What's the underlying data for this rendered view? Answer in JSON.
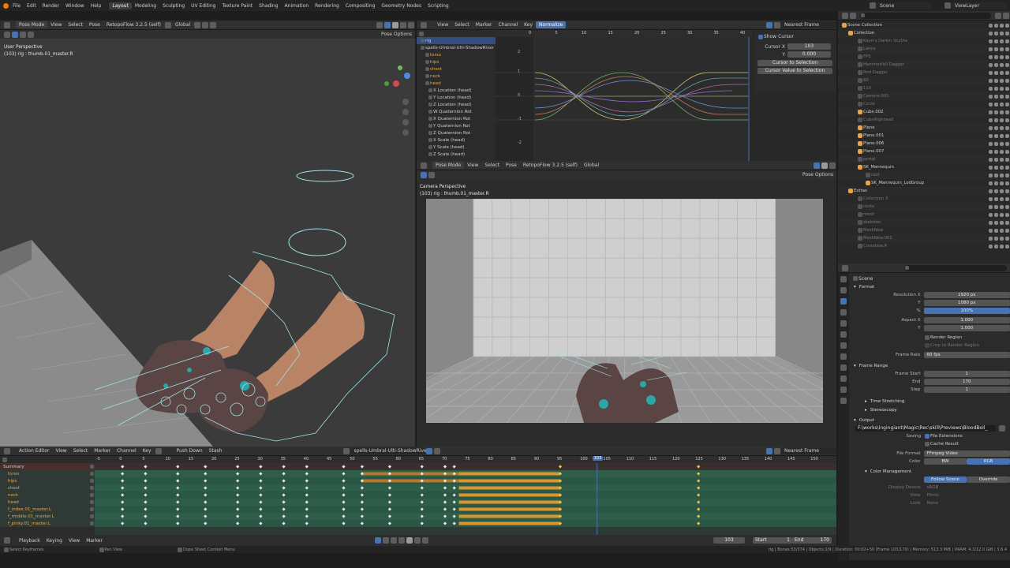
{
  "menubar": {
    "items": [
      "File",
      "Edit",
      "Render",
      "Window",
      "Help"
    ],
    "workspaces": [
      "Layout",
      "Modeling",
      "Sculpting",
      "UV Editing",
      "Texture Paint",
      "Shading",
      "Animation",
      "Rendering",
      "Compositing",
      "Geometry Nodes",
      "Scripting"
    ],
    "scene": "Scene",
    "view_layer": "ViewLayer"
  },
  "viewport3d": {
    "mode": "Pose Mode",
    "menus": [
      "View",
      "Select",
      "Pose"
    ],
    "retopo": "RetopoFlow 3.2.5 (self)",
    "orientation": "Global",
    "pose_options": "Pose Options",
    "perspective": "User Perspective",
    "object": "(103) rig : thumb.01_master.R"
  },
  "graph_editor": {
    "menus": [
      "View",
      "Select",
      "Marker",
      "Channel",
      "Key"
    ],
    "normalize": "Normalize",
    "nearest": "Nearest Frame",
    "ruler": [
      "0",
      "5",
      "10",
      "15",
      "20",
      "25",
      "30",
      "35",
      "40"
    ],
    "y_labels": [
      "2",
      "1",
      "0",
      "-1",
      "-2"
    ],
    "channels": [
      {
        "label": "rig",
        "orange": false
      },
      {
        "label": "spells-Umbral-Ulti-ShadowRiver",
        "orange": false
      },
      {
        "label": "torso",
        "orange": true
      },
      {
        "label": "hips",
        "orange": true
      },
      {
        "label": "chest",
        "orange": true
      },
      {
        "label": "neck",
        "orange": true
      },
      {
        "label": "head",
        "orange": true
      },
      {
        "label": "X Location (head)",
        "orange": false
      },
      {
        "label": "Y Location (head)",
        "orange": false
      },
      {
        "label": "Z Location (head)",
        "orange": false
      },
      {
        "label": "W Quaternion Rot",
        "orange": false
      },
      {
        "label": "X Quaternion Rot",
        "orange": false
      },
      {
        "label": "Y Quaternion Rot",
        "orange": false
      },
      {
        "label": "Z Quaternion Rot",
        "orange": false
      },
      {
        "label": "X Scale (head)",
        "orange": false
      },
      {
        "label": "Y Scale (head)",
        "orange": false
      },
      {
        "label": "Z Scale (head)",
        "orange": false
      }
    ],
    "sidebar": {
      "show_cursor": "Show Cursor",
      "cursor_x_label": "Cursor X",
      "cursor_x": "103",
      "y_label": "Y",
      "cursor_y": "0.000",
      "btn1": "Cursor to Selection",
      "btn2": "Cursor Value to Selection"
    }
  },
  "camera_view": {
    "mode": "Pose Mode",
    "menus": [
      "View",
      "Select",
      "Pose"
    ],
    "retopo": "RetopoFlow 3.2.5 (self)",
    "orientation": "Global",
    "pose_options": "Pose Options",
    "perspective": "Camera Perspective",
    "object": "(103) rig : thumb.01_master.R"
  },
  "outliner": {
    "items": [
      {
        "label": "Scene Collection",
        "dim": false
      },
      {
        "label": "Collection",
        "dim": false
      },
      {
        "label": "Kayn's Darkin Scythe",
        "dim": true
      },
      {
        "label": "Lance",
        "dim": true
      },
      {
        "label": "FPS",
        "dim": true
      },
      {
        "label": "Hammerfell Dagger",
        "dim": true
      },
      {
        "label": "Red Dagger",
        "dim": true
      },
      {
        "label": "60",
        "dim": true
      },
      {
        "label": "110",
        "dim": true
      },
      {
        "label": "Camera.001",
        "dim": true
      },
      {
        "label": "Circle",
        "dim": true
      },
      {
        "label": "Cube.002",
        "dim": false
      },
      {
        "label": "CubeRightwall",
        "dim": true
      },
      {
        "label": "Plane",
        "dim": false
      },
      {
        "label": "Plane.001",
        "dim": false
      },
      {
        "label": "Plane.006",
        "dim": false
      },
      {
        "label": "Plane.007",
        "dim": false
      },
      {
        "label": "portal",
        "dim": true
      },
      {
        "label": "SK_Mannequin",
        "dim": false
      },
      {
        "label": "root",
        "dim": true
      },
      {
        "label": "SK_Mannequin_LodGroup",
        "dim": false
      },
      {
        "label": "Extras",
        "dim": false
      },
      {
        "label": "Collection 3",
        "dim": true
      },
      {
        "label": "rocks",
        "dim": true
      },
      {
        "label": "mesh",
        "dim": true
      },
      {
        "label": "skeleton",
        "dim": true
      },
      {
        "label": "MeshNew",
        "dim": true
      },
      {
        "label": "MeshNew.001",
        "dim": true
      },
      {
        "label": "Crossbow.R",
        "dim": true
      }
    ]
  },
  "properties": {
    "scene_label": "Scene",
    "format": {
      "title": "Format",
      "res_x_label": "Resolution X",
      "res_x": "1920 px",
      "y_label": "Y",
      "res_y": "1080 px",
      "pct_label": "%",
      "pct": "100%",
      "aspect_x_label": "Aspect X",
      "aspect_x": "1.000",
      "aspect_y": "1.000",
      "render_region": "Render Region",
      "crop": "Crop to Render Region",
      "frame_rate_label": "Frame Rate",
      "frame_rate": "60 fps"
    },
    "frame_range": {
      "title": "Frame Range",
      "start_label": "Frame Start",
      "start": "1",
      "end_label": "End",
      "end": "170",
      "step_label": "Step",
      "step": "1"
    },
    "time_stretching": "Time Stretching",
    "stereoscopy": "Stereoscopy",
    "output": {
      "title": "Output",
      "path": "F:\\works\\ingingiant\\Magic\\Rec\\skill\\Previews\\BloodBoil_",
      "saving_label": "Saving",
      "file_ext": "File Extensions",
      "cache": "Cache Result",
      "file_format_label": "File Format",
      "file_format": "FFmpeg Video",
      "color_label": "Color",
      "bw": "BW",
      "rgb": "RGB"
    },
    "color_management": {
      "title": "Color Management",
      "follow": "Follow Scene",
      "override": "Override",
      "display_device_label": "Display Device",
      "display_device": "sRGB",
      "view_label": "View",
      "view": "Filmic",
      "look_label": "Look",
      "look": "None"
    }
  },
  "dopesheet": {
    "mode": "Action Editor",
    "menus": [
      "View",
      "Select",
      "Marker",
      "Channel",
      "Key"
    ],
    "push_down": "Push Down",
    "stash": "Stash",
    "action": "spells-Umbral-Ulti-ShadowRiver",
    "nearest": "Nearest Frame",
    "ruler": [
      "-5",
      "0",
      "5",
      "10",
      "15",
      "20",
      "25",
      "30",
      "35",
      "40",
      "45",
      "50",
      "55",
      "60",
      "65",
      "70",
      "75",
      "80",
      "85",
      "90",
      "95",
      "100",
      "105",
      "110",
      "115",
      "120",
      "125",
      "130",
      "135",
      "140",
      "145",
      "150"
    ],
    "current_frame": "103",
    "channels": [
      {
        "label": "Summary",
        "orange": false
      },
      {
        "label": "torso",
        "orange": true
      },
      {
        "label": "hips",
        "orange": true
      },
      {
        "label": "chest",
        "orange": true
      },
      {
        "label": "neck",
        "orange": true
      },
      {
        "label": "head",
        "orange": true
      },
      {
        "label": "f_index.01_master.L",
        "orange": true
      },
      {
        "label": "f_middle.01_master.L",
        "orange": true
      },
      {
        "label": "f_pinky.01_master.L",
        "orange": true
      }
    ]
  },
  "timeline": {
    "menus": [
      "Playback",
      "Keying",
      "View",
      "Marker"
    ],
    "frame": "103",
    "start_label": "Start",
    "start": "1",
    "end_label": "End",
    "end": "170"
  },
  "statusbar": {
    "left1": "Select Keyframes",
    "left2": "Pan View",
    "left3": "Dope Sheet Context Menu",
    "right": "rig | Bones:53/374 | Objects:1/9 | Duration: 00:02+50 (Frame 103/170) | Memory: 513.3 MiB | VRAM: 4.3/12.0 GiB | 3.6.4"
  },
  "colors": {
    "accent": "#4772b3",
    "orange": "#e9a64a",
    "key_green": "#2e5e4a",
    "key_orange": "#d8962f"
  }
}
